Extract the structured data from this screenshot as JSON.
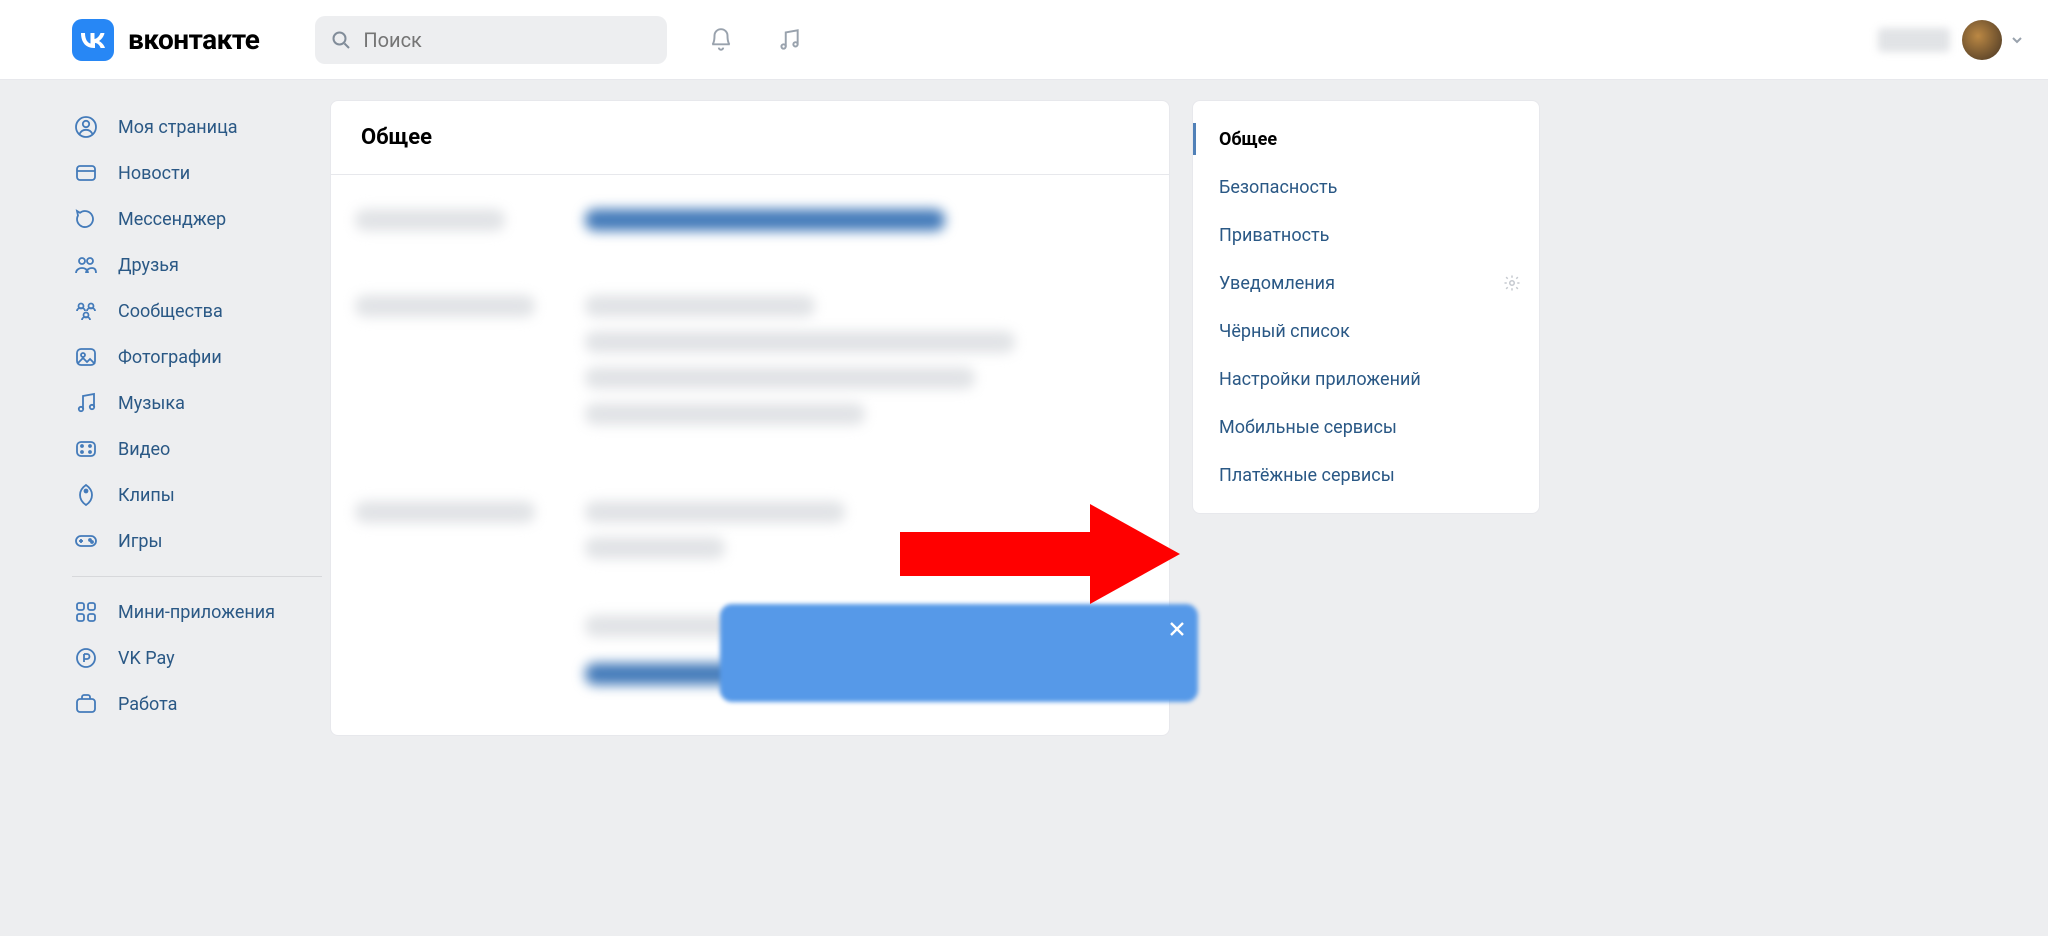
{
  "header": {
    "brand": "вконтакте",
    "search_placeholder": "Поиск"
  },
  "leftnav": {
    "items": [
      {
        "icon": "profile-icon",
        "label": "Моя страница"
      },
      {
        "icon": "news-icon",
        "label": "Новости"
      },
      {
        "icon": "messenger-icon",
        "label": "Мессенджер"
      },
      {
        "icon": "friends-icon",
        "label": "Друзья"
      },
      {
        "icon": "communities-icon",
        "label": "Сообщества"
      },
      {
        "icon": "photos-icon",
        "label": "Фотографии"
      },
      {
        "icon": "music-icon",
        "label": "Музыка"
      },
      {
        "icon": "video-icon",
        "label": "Видео"
      },
      {
        "icon": "clips-icon",
        "label": "Клипы"
      },
      {
        "icon": "games-icon",
        "label": "Игры"
      }
    ],
    "items2": [
      {
        "icon": "miniapps-icon",
        "label": "Мини-приложения"
      },
      {
        "icon": "vkpay-icon",
        "label": "VK Pay"
      },
      {
        "icon": "work-icon",
        "label": "Работа"
      }
    ]
  },
  "main": {
    "title": "Общее"
  },
  "rightnav": {
    "items": [
      {
        "label": "Общее",
        "active": true
      },
      {
        "label": "Безопасность"
      },
      {
        "label": "Приватность"
      },
      {
        "label": "Уведомления",
        "gear": true
      },
      {
        "label": "Чёрный список"
      },
      {
        "label": "Настройки приложений"
      },
      {
        "label": "Мобильные сервисы"
      },
      {
        "label": "Платёжные сервисы"
      }
    ]
  }
}
